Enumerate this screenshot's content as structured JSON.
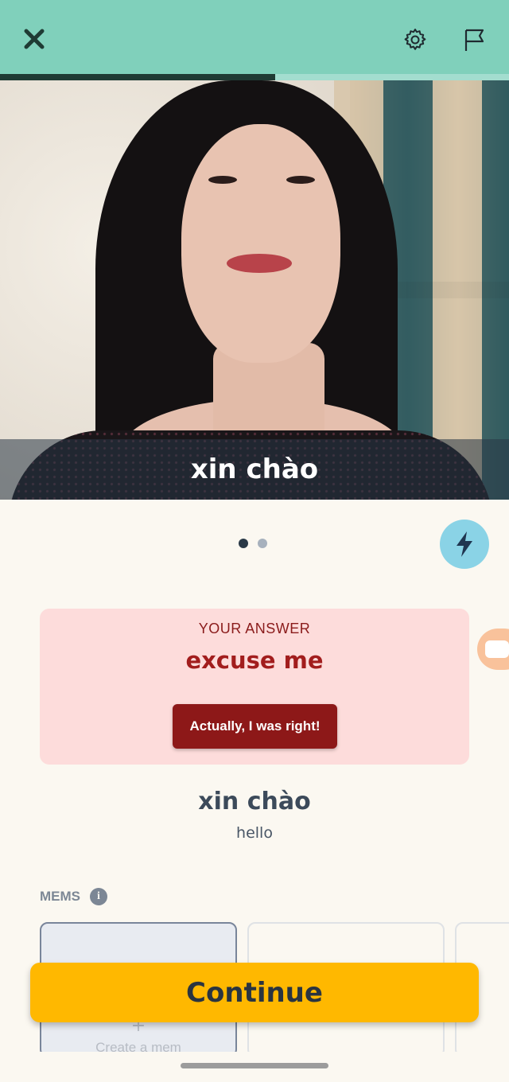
{
  "header": {
    "close_icon": "close-icon",
    "settings_icon": "gear-icon",
    "report_icon": "flag-icon",
    "progress_fraction": 0.54
  },
  "video": {
    "caption": "xin chào"
  },
  "pager": {
    "pages": 2,
    "current": 1,
    "boost_icon": "lightning-icon"
  },
  "answer": {
    "label": "YOUR ANSWER",
    "text": "excuse me",
    "override_button": "Actually, I was right!"
  },
  "word": {
    "target": "xin chào",
    "translation": "hello"
  },
  "mems": {
    "label": "MEMS",
    "info_icon": "i",
    "create_plus": "+",
    "create_label": "Create a mem"
  },
  "footer": {
    "continue_label": "Continue"
  },
  "colors": {
    "header_bg": "#80d0bb",
    "progress_fill": "#1f3b34",
    "answer_bg": "#fddcdb",
    "answer_text": "#a21d1d",
    "button_dark_red": "#8d1818",
    "continue_bg": "#ffb800",
    "bolt_bg": "#8ad3e6"
  }
}
